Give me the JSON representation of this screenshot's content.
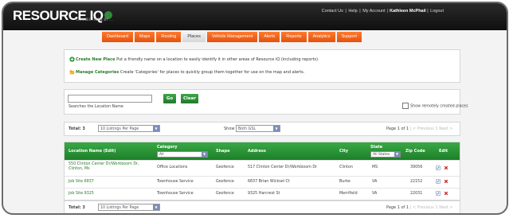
{
  "header": {
    "logo_text": "RESOURCE IQ",
    "tagline": "CONNECTIONS BY ...",
    "links": [
      "Contact Us",
      "Help",
      "My Account",
      "Kathleen McPhail",
      "Logout"
    ]
  },
  "nav": {
    "tabs": [
      "Dashboard",
      "Maps",
      "Routing",
      "Places",
      "Vehicle Management",
      "Alerts",
      "Reports",
      "Analytics",
      "Support"
    ],
    "active": "Places"
  },
  "info": {
    "create_link": "Create New Place",
    "create_text": "Put a friendly name on a location to easily identify it in other areas of Resource iQ (including reports).",
    "manage_link": "Manage Categories",
    "manage_text": "Create 'Categories' for places to quickly group them together for use on the map and alerts."
  },
  "search": {
    "value": "",
    "go_label": "Go",
    "clear_label": "Clear",
    "caption": "Searches the Location Name",
    "remote_label": "Show remotely created places"
  },
  "toolbar": {
    "total": "Total: 3",
    "per_page": "10 Listings Per Page",
    "show_label": "Show",
    "show_value": "Both GSL",
    "page_text": "Page 1 of 1",
    "page_nav": "| < Previous 1 Next >"
  },
  "table": {
    "columns": [
      "Location Name (Edit)",
      "Category",
      "Shape",
      "Address",
      "City",
      "State",
      "Zip Code",
      "Edit"
    ],
    "category_filter": "All",
    "state_filter": "All States",
    "rows": [
      {
        "name": "550 Clinton Center Dr/Workboom Dr, Clinton, Ms",
        "category": "Office Locations",
        "shape": "Geofence",
        "address": "517 Clinton Center Dr/Workboom Dr",
        "city": "Clinton",
        "state": "MS",
        "zip": "39056"
      },
      {
        "name": "Job Site 6837",
        "category": "Townhouse Service",
        "shape": "Geofence",
        "address": "6837 Brian Wicksel Ct",
        "city": "Burke",
        "state": "VA",
        "zip": "22152"
      },
      {
        "name": "Job Site 9325",
        "category": "Townhouse Service",
        "shape": "Geofence",
        "address": "9325 Harcrest St",
        "city": "Merrifield",
        "state": "VA",
        "zip": "22031"
      }
    ]
  },
  "footer_toolbar": {
    "total": "Total: 3",
    "per_page": "10 Listings Per Page",
    "page_text": "Page 1 of 1",
    "page_nav": "| < Previous 1 Next >"
  },
  "colors": {
    "nav_orange": "#e8600f",
    "header_green": "#2a9238",
    "link_green": "#2a7a2a",
    "delete_red": "#d02020"
  }
}
